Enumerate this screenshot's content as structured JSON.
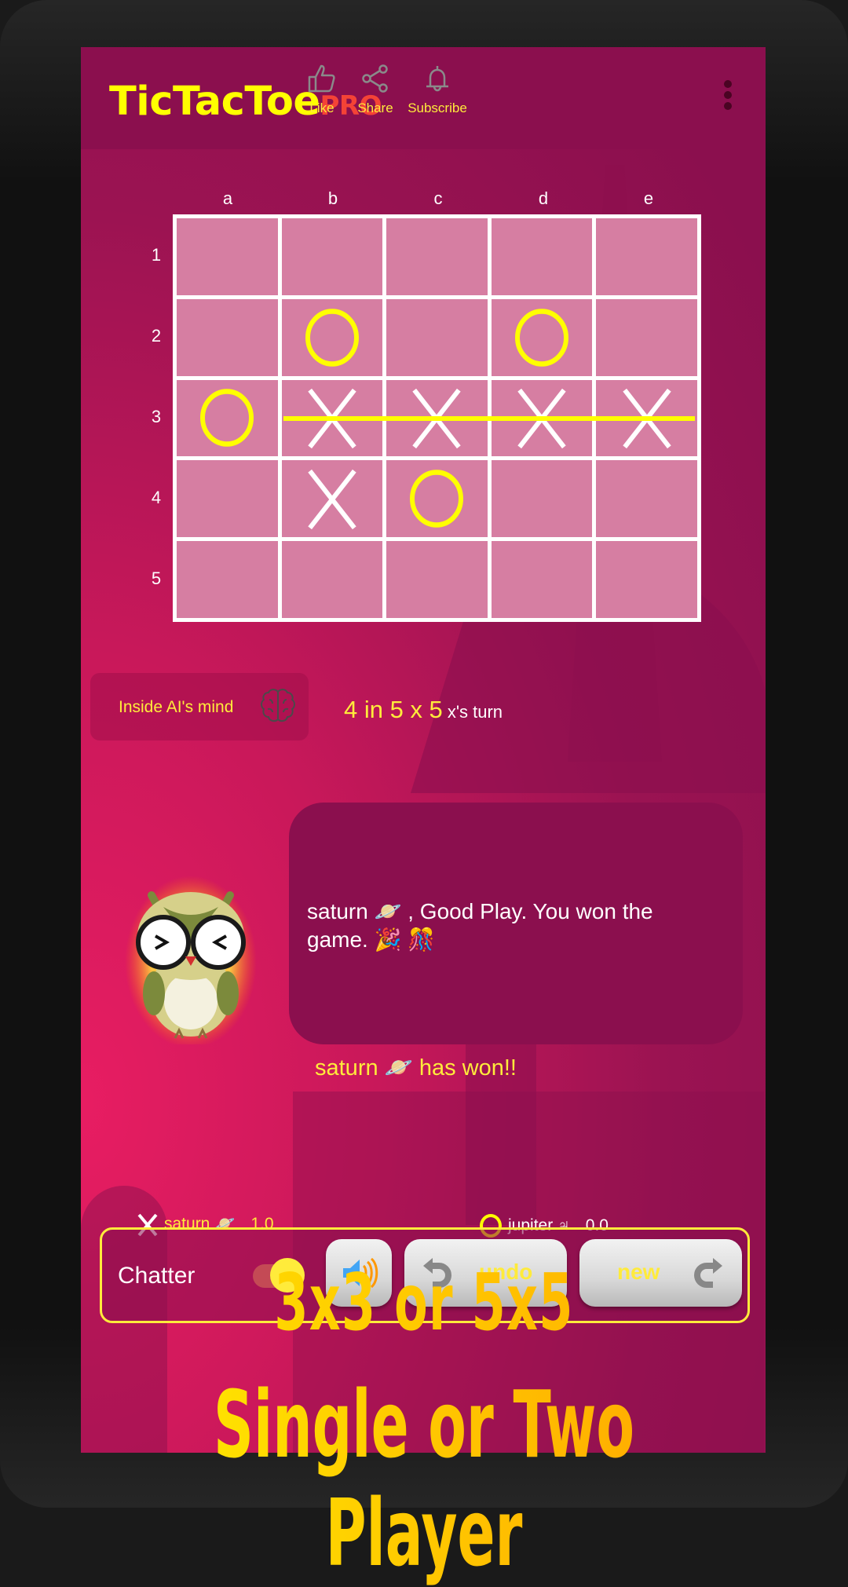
{
  "header": {
    "title": "TicTacToe",
    "title_suffix": "PRO",
    "actions": [
      {
        "label": "Like",
        "icon": "thumbs-up-icon"
      },
      {
        "label": "Share",
        "icon": "share-icon"
      },
      {
        "label": "Subscribe",
        "icon": "bell-icon"
      }
    ],
    "menu_icon": "more-vert-icon"
  },
  "board": {
    "columns": [
      "a",
      "b",
      "c",
      "d",
      "e"
    ],
    "rows": [
      "1",
      "2",
      "3",
      "4",
      "5"
    ],
    "cells": [
      [
        "",
        "",
        "",
        "",
        ""
      ],
      [
        "",
        "O",
        "",
        "O",
        ""
      ],
      [
        "O",
        "X",
        "X",
        "X",
        "X"
      ],
      [
        "",
        "X",
        "O",
        "",
        ""
      ],
      [
        "",
        "",
        "",
        "",
        ""
      ]
    ],
    "winning_line": {
      "row": "3",
      "from": "b",
      "to": "e"
    }
  },
  "ai_button": {
    "label": "Inside AI's mind",
    "icon": "brain-icon"
  },
  "status": {
    "mode": "4 in 5 x 5",
    "turn": "x's turn"
  },
  "chat": {
    "message": "saturn 🪐 , Good Play. You won the game. 🎉 🎊",
    "avatar": "owl-mascot"
  },
  "result": "saturn 🪐  has won!!",
  "scores": [
    {
      "symbol": "X",
      "name": "saturn 🪐",
      "score": "1.0"
    },
    {
      "symbol": "O",
      "name": "jupiter ♃",
      "score": "0.0"
    }
  ],
  "controls": {
    "chatter_label": "Chatter",
    "chatter_on": true,
    "sound_icon": "speaker-icon",
    "undo_label": "undo",
    "new_label": "new"
  },
  "promo": {
    "line1": "3x3 or 5x5",
    "line2": "Single or Two Player"
  },
  "colors": {
    "header_bg": "#8b0f4e",
    "accent_yellow": "#ffff00",
    "pro_red": "#f44336",
    "bg_pink": "#e81d62"
  }
}
